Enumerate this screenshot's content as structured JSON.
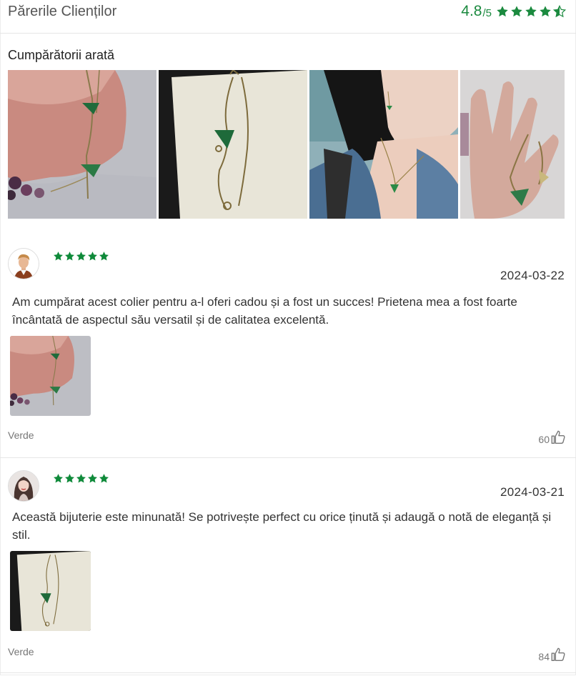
{
  "header": {
    "title": "Părerile Clienților",
    "rating": "4.8",
    "rating_max": "/5",
    "accent_color": "#1b8a3f",
    "rating_star_icons": [
      "star-full-icon",
      "star-full-icon",
      "star-full-icon",
      "star-full-icon",
      "star-half-icon"
    ]
  },
  "gallery": {
    "title": "Cumpărătorii arată",
    "images": [
      {
        "icon": "photo-necklace-wrist"
      },
      {
        "icon": "photo-necklace-on-card"
      },
      {
        "icon": "photo-woman-wearing-necklace"
      },
      {
        "icon": "photo-necklace-in-hand"
      }
    ]
  },
  "reviews": [
    {
      "avatar_icon": "avatar-man-icon",
      "stars": 5,
      "date": "2024-03-22",
      "text": "Am cumpărat acest colier pentru a-l oferi cadou și a fost un succes! Prietena mea a fost foarte încântată de aspectul său versatil și de calitatea excelentă.",
      "photo_icon": "photo-necklace-wrist",
      "variant": "Verde",
      "likes": "60"
    },
    {
      "avatar_icon": "avatar-woman-icon",
      "stars": 5,
      "date": "2024-03-21",
      "text": "Această bijuterie este minunată! Se potrivește perfect cu orice ținută și adaugă o notă de eleganță și stil.",
      "photo_icon": "photo-necklace-on-card",
      "variant": "Verde",
      "likes": "84"
    }
  ]
}
